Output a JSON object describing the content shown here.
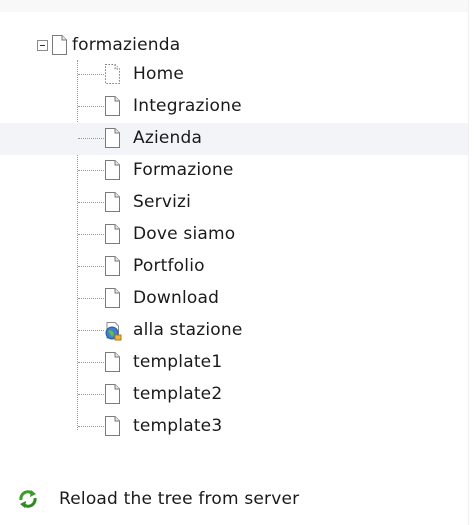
{
  "tree": {
    "root": {
      "label": "formazienda",
      "expanded": true,
      "icon": "page-icon"
    },
    "items": [
      {
        "label": "Home",
        "icon": "page-dotted-icon",
        "selected": false
      },
      {
        "label": "Integrazione",
        "icon": "page-icon",
        "selected": false
      },
      {
        "label": "Azienda",
        "icon": "page-icon",
        "selected": true
      },
      {
        "label": "Formazione",
        "icon": "page-icon",
        "selected": false
      },
      {
        "label": "Servizi",
        "icon": "page-icon",
        "selected": false
      },
      {
        "label": "Dove siamo",
        "icon": "page-icon",
        "selected": false
      },
      {
        "label": "Portfolio",
        "icon": "page-icon",
        "selected": false
      },
      {
        "label": "Download",
        "icon": "page-icon",
        "selected": false
      },
      {
        "label": "alla stazione",
        "icon": "globe-link-icon",
        "selected": false
      },
      {
        "label": "template1",
        "icon": "page-icon",
        "selected": false
      },
      {
        "label": "template2",
        "icon": "page-icon",
        "selected": false
      },
      {
        "label": "template3",
        "icon": "page-icon",
        "selected": false
      }
    ]
  },
  "reload": {
    "label": "Reload the tree from server",
    "icon": "reload-icon"
  },
  "colors": {
    "selected_row": "#f3f4f7",
    "connector": "#9a9a9a",
    "reload_green": "#3a9a2a"
  }
}
